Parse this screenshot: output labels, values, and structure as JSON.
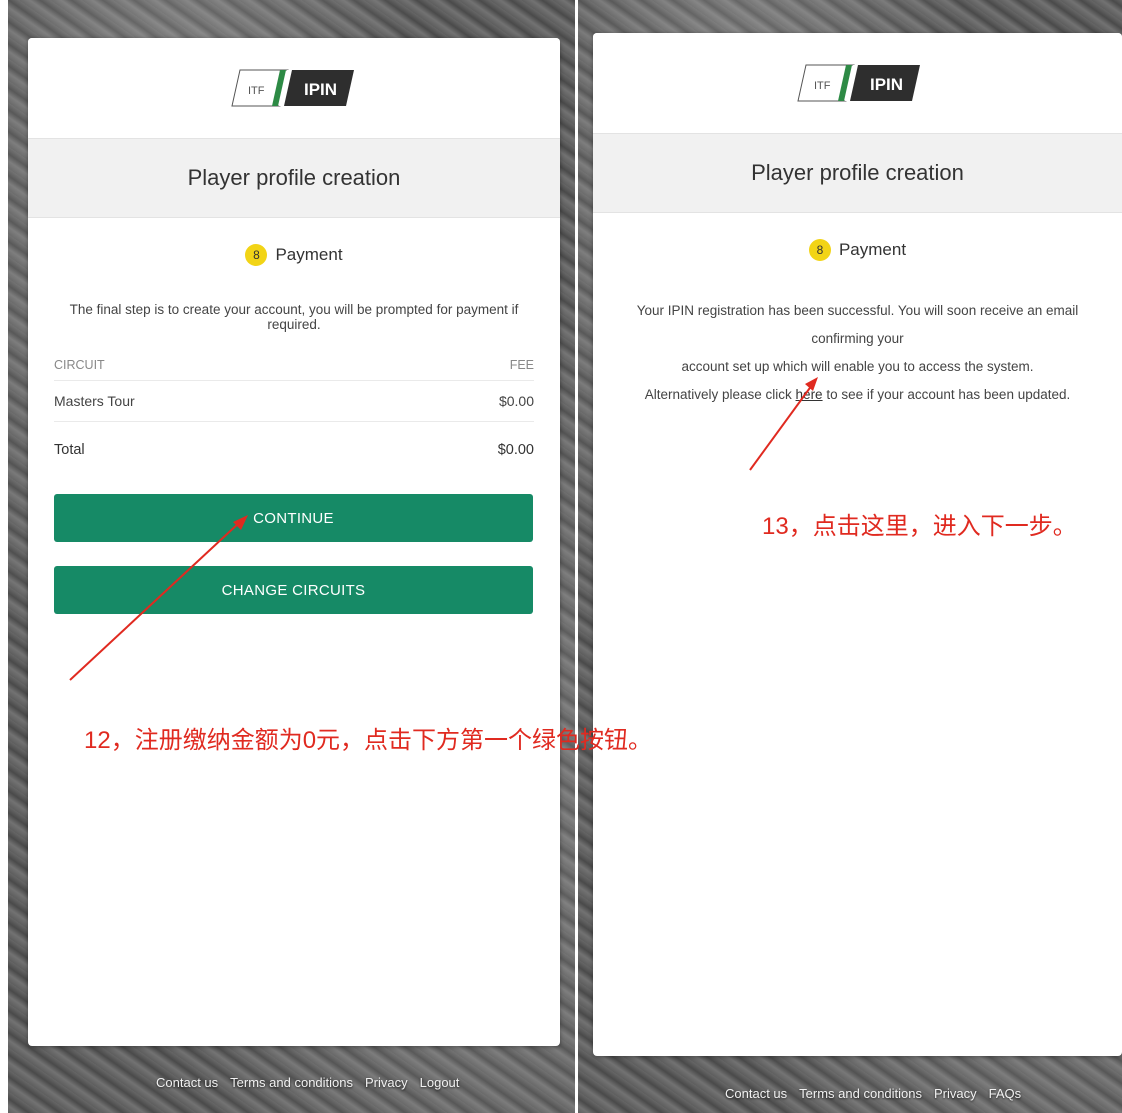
{
  "left_panel": {
    "logo": {
      "brand": "ITF",
      "product": "IPIN"
    },
    "title": "Player profile creation",
    "step": {
      "number": "8",
      "label": "Payment"
    },
    "intro": "The final step is to create your account, you will be prompted for payment if required.",
    "table": {
      "headers": [
        "CIRCUIT",
        "FEE"
      ],
      "rows": [
        {
          "circuit": "Masters Tour",
          "fee": "$0.00"
        }
      ],
      "total_label": "Total",
      "total_value": "$0.00"
    },
    "buttons": {
      "continue": "CONTINUE",
      "change_circuits": "CHANGE CIRCUITS"
    },
    "annotation": "12，注册缴纳金额为0元，点击下方第一个绿色按钮。",
    "footer": [
      "Contact us",
      "Terms and conditions",
      "Privacy",
      "Logout"
    ]
  },
  "right_panel": {
    "logo": {
      "brand": "ITF",
      "product": "IPIN"
    },
    "title": "Player profile creation",
    "step": {
      "number": "8",
      "label": "Payment"
    },
    "message": {
      "line1": "Your IPIN registration has been successful. You will soon receive an email confirming your",
      "line2": "account set up which will enable you to access the system.",
      "line3_prefix": "Alternatively please click ",
      "line3_link": "here",
      "line3_suffix": " to see if your account has been updated."
    },
    "annotation": "13，点击这里，进入下一步。",
    "footer": [
      "Contact us",
      "Terms and conditions",
      "Privacy",
      "FAQs"
    ]
  },
  "colors": {
    "primary_button": "#168a66",
    "step_badge": "#f2d416",
    "annotation": "#e02a20"
  }
}
